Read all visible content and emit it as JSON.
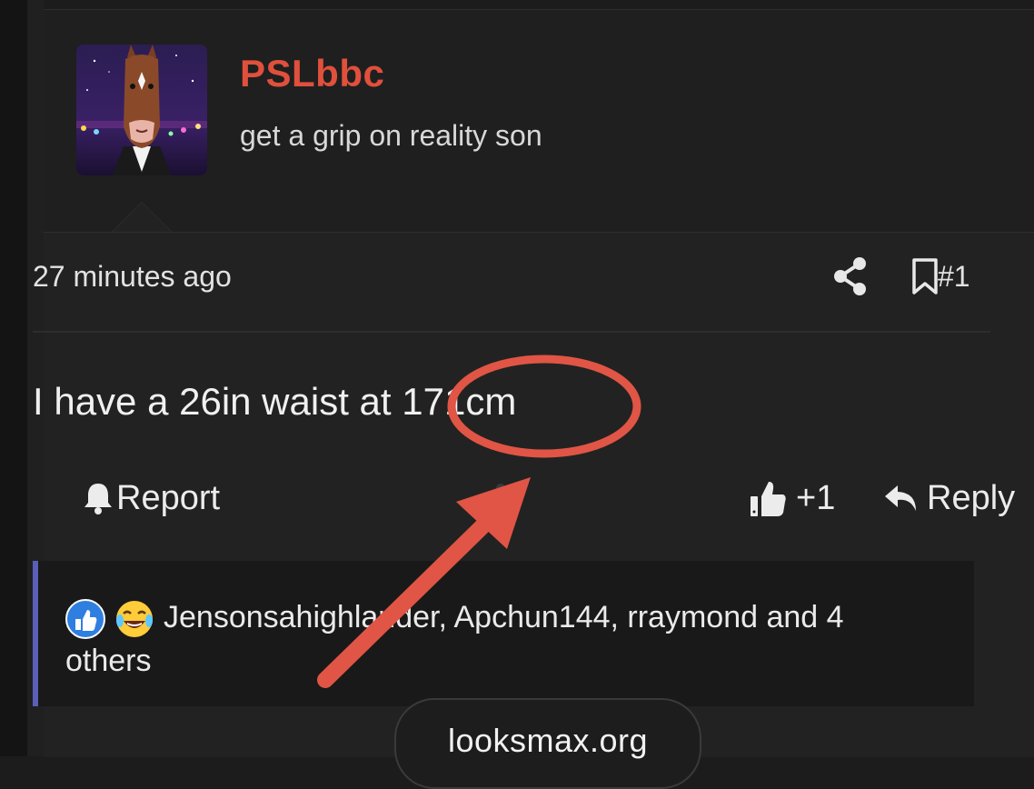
{
  "post": {
    "user": {
      "name": "PSLbbc",
      "title": "get a grip on reality son",
      "avatar_icon": "bojack-horseman-avatar"
    },
    "meta": {
      "time": "27 minutes ago",
      "post_number": "#1",
      "share_icon": "share-icon",
      "bookmark_icon": "bookmark-icon"
    },
    "message": "I have a 26in waist at 171cm",
    "actions": {
      "report": "Report",
      "like_count": "+1",
      "reply": "Reply"
    },
    "reactions": {
      "text": "Jensonsahighlander, Apchun144, rraymond and 4 others",
      "icons": [
        "like-reaction-icon",
        "laugh-cry-reaction-icon"
      ]
    }
  },
  "watermark": "looksmax.org",
  "colors": {
    "username": "#e0503c",
    "annotation": "#e05545",
    "reaction_border": "#5a5fb8"
  }
}
